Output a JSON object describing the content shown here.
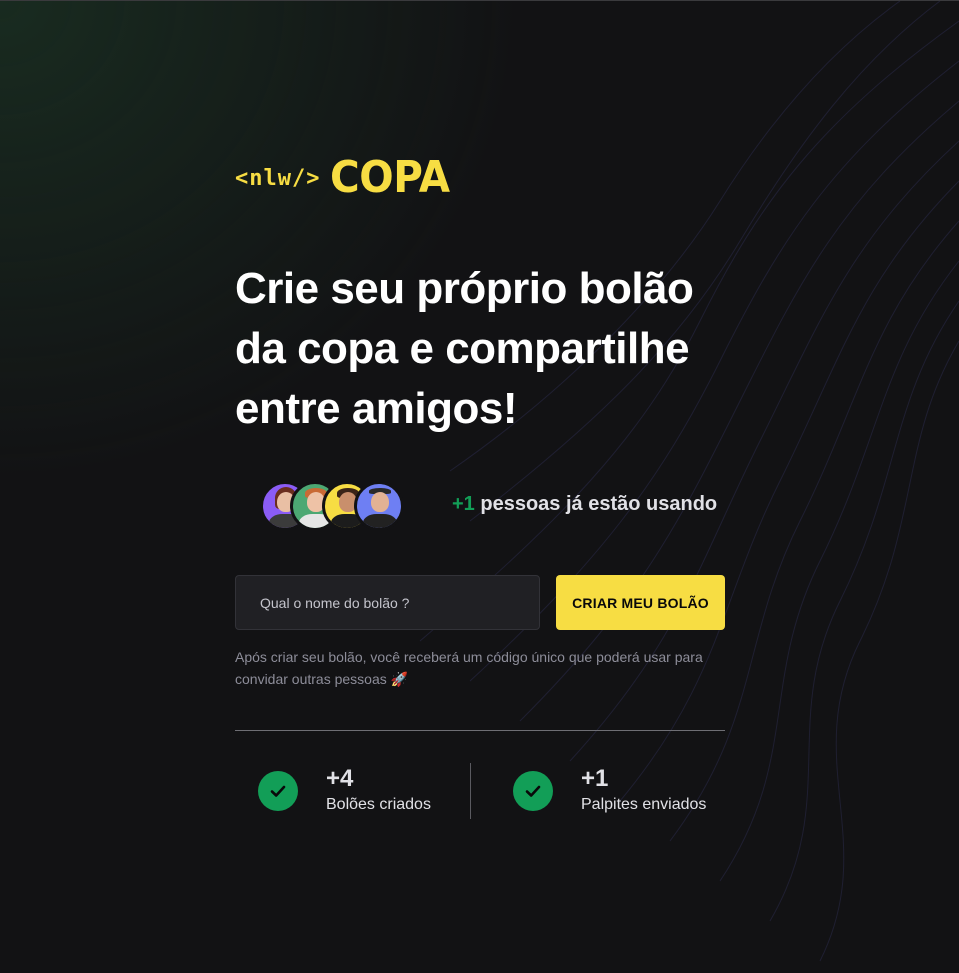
{
  "logo": {
    "prefix": "<nlw/>",
    "name": "COPA"
  },
  "hero": {
    "line1": "Crie seu próprio bolão",
    "line2": "da copa e compartilhe",
    "line3": "entre amigos!"
  },
  "users": {
    "count": "+1",
    "text": "pessoas já estão usando"
  },
  "form": {
    "placeholder": "Qual o nome do bolão ?",
    "value": "",
    "button_label": "CRIAR MEU BOLÃO"
  },
  "helper": "Após criar seu bolão, você receberá um código único que poderá usar para convidar outras pessoas 🚀",
  "stats": [
    {
      "value": "+4",
      "label": "Bolões criados"
    },
    {
      "value": "+1",
      "label": "Palpites enviados"
    }
  ],
  "colors": {
    "accent_yellow": "#F7DD43",
    "accent_green": "#129E57",
    "background": "#121214",
    "input_bg": "#202024"
  },
  "icons": [
    "check-icon"
  ]
}
